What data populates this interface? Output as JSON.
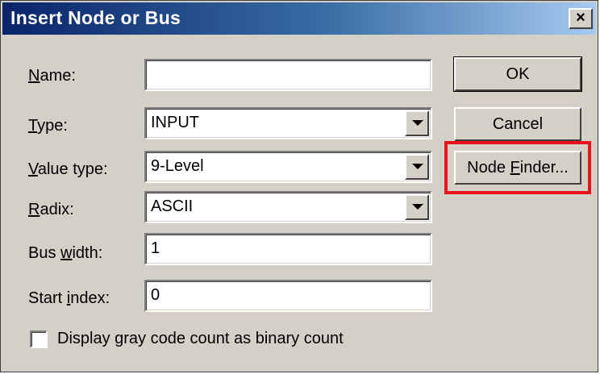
{
  "window": {
    "title": "Insert Node or Bus",
    "close_glyph": "×"
  },
  "fields": {
    "name": {
      "label_underlined": "N",
      "label_rest": "ame:",
      "value": ""
    },
    "type": {
      "label_underlined": "T",
      "label_rest": "ype:",
      "value": "INPUT"
    },
    "value_type": {
      "label_underlined": "V",
      "label_rest": "alue type:",
      "value": "9-Level"
    },
    "radix": {
      "label_underlined": "R",
      "label_rest": "adix:",
      "value": "ASCII"
    },
    "bus_width": {
      "label_pre": "Bus ",
      "label_underlined": "w",
      "label_rest": "idth:",
      "value": "1"
    },
    "start_index": {
      "label_pre": "Start ",
      "label_underlined": "i",
      "label_rest": "ndex:",
      "value": "0"
    }
  },
  "buttons": {
    "ok": "OK",
    "cancel": "Cancel",
    "node_finder_pre": "Node ",
    "node_finder_underlined": "F",
    "node_finder_rest": "inder..."
  },
  "checkbox": {
    "label_pre": "Display ",
    "label_underlined": "g",
    "label_rest": "ray code count as binary count",
    "checked": false
  },
  "colors": {
    "highlight": "#e8141a",
    "dialog_face": "#d4d0c8",
    "title_start": "#0a246a"
  }
}
